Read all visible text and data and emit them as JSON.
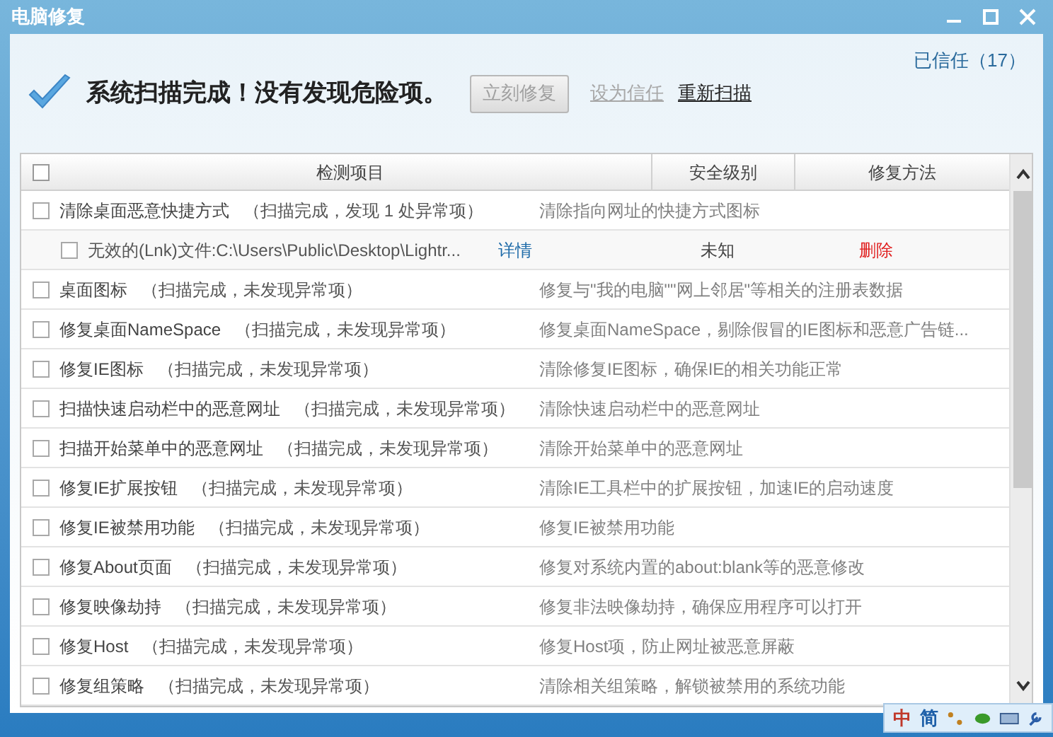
{
  "window": {
    "title": "电脑修复"
  },
  "trusted": "已信任（17）",
  "status": {
    "message": "系统扫描完成！没有发现危险项。",
    "fix_button": {
      "label": "立刻修复",
      "disabled": true
    },
    "trust_link": {
      "label": "设为信任",
      "disabled": true
    },
    "rescan_link": {
      "label": "重新扫描",
      "disabled": false
    }
  },
  "table": {
    "select_all": {
      "checked": false
    },
    "columns": [
      "检测项目",
      "安全级别",
      "修复方法"
    ],
    "rows": [
      {
        "kind": "item",
        "checked": false,
        "name": "清除桌面恶意快捷方式",
        "result": "（扫描完成，发现 1 处异常项）",
        "description": "清除指向网址的快捷方式图标"
      },
      {
        "kind": "detail",
        "checked": false,
        "name": "无效的(Lnk)文件:C:\\Users\\Public\\Desktop\\Lightr...",
        "link": "详情",
        "level": "未知",
        "action": "删除"
      },
      {
        "kind": "item",
        "checked": false,
        "name": "桌面图标",
        "result": "（扫描完成，未发现异常项）",
        "description": "修复与\"我的电脑\"\"网上邻居\"等相关的注册表数据"
      },
      {
        "kind": "item",
        "checked": false,
        "name": "修复桌面NameSpace",
        "result": "（扫描完成，未发现异常项）",
        "description": "修复桌面NameSpace，剔除假冒的IE图标和恶意广告链..."
      },
      {
        "kind": "item",
        "checked": false,
        "name": "修复IE图标",
        "result": "（扫描完成，未发现异常项）",
        "description": "清除修复IE图标，确保IE的相关功能正常"
      },
      {
        "kind": "item",
        "checked": false,
        "name": "扫描快速启动栏中的恶意网址",
        "result": "（扫描完成，未发现异常项）",
        "description": "清除快速启动栏中的恶意网址"
      },
      {
        "kind": "item",
        "checked": false,
        "name": "扫描开始菜单中的恶意网址",
        "result": "（扫描完成，未发现异常项）",
        "description": "清除开始菜单中的恶意网址"
      },
      {
        "kind": "item",
        "checked": false,
        "name": "修复IE扩展按钮",
        "result": "（扫描完成，未发现异常项）",
        "description": "清除IE工具栏中的扩展按钮，加速IE的启动速度"
      },
      {
        "kind": "item",
        "checked": false,
        "name": "修复IE被禁用功能",
        "result": "（扫描完成，未发现异常项）",
        "description": "修复IE被禁用功能"
      },
      {
        "kind": "item",
        "checked": false,
        "name": "修复About页面",
        "result": "（扫描完成，未发现异常项）",
        "description": "修复对系统内置的about:blank等的恶意修改"
      },
      {
        "kind": "item",
        "checked": false,
        "name": "修复映像劫持",
        "result": "（扫描完成，未发现异常项）",
        "description": "修复非法映像劫持，确保应用程序可以打开"
      },
      {
        "kind": "item",
        "checked": false,
        "name": "修复Host",
        "result": "（扫描完成，未发现异常项）",
        "description": "修复Host项，防止网址被恶意屏蔽"
      },
      {
        "kind": "item",
        "checked": false,
        "name": "修复组策略",
        "result": "（扫描完成，未发现异常项）",
        "description": "清除相关组策略，解锁被禁用的系统功能"
      }
    ]
  },
  "ime_bar": {
    "items": [
      "中",
      "简"
    ]
  }
}
